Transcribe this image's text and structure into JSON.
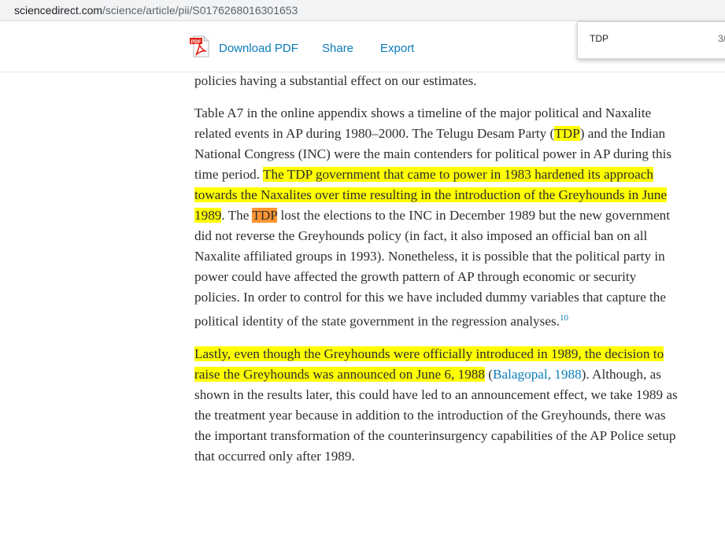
{
  "browser": {
    "url_domain": "sciencedirect.com",
    "url_path": "/science/article/pii/S0176268016301653"
  },
  "toolbar": {
    "pdf_icon_text": "PDF",
    "download_pdf": "Download PDF",
    "share": "Share",
    "export": "Export"
  },
  "find": {
    "query": "TDP",
    "count": "3/"
  },
  "colors": {
    "link": "#0c7dbb",
    "highlight": "#ffff00",
    "current_match": "#ff9632"
  },
  "article": {
    "p0": "policies having a substantial effect on our estimates.",
    "p1": {
      "s01": "Table A7 in the online appendix shows a timeline of the major political and Naxalite related events in AP during 1980–2000. The Telugu Desam Party (",
      "m1": "TDP",
      "s02": ") and the Indian National Congress (INC) were the main contenders for political power in AP during this time period. ",
      "h1": "The ",
      "m2": "TDP",
      "h2": " government that came to power in 1983 hardened its approach towards the Naxalites over time resulting in the introduction of the Greyhounds in June 1989",
      "s03": ". The ",
      "m3": "TDP",
      "s04": " lost the elections to the INC in December 1989 but the new government did not reverse the Greyhounds policy (in fact, it also imposed an official ban on all Naxalite affiliated groups in 1993). Nonetheless, it is possible that the political party in power could have affected the growth pattern of AP through economic or security policies. In order to control for this we have included dummy variables that capture the political identity of the state government in the regression analyses.",
      "footnote": "10"
    },
    "p2": {
      "h1": "Lastly, even though the Greyhounds were officially introduced in 1989, the decision to raise the Greyhounds was announced on June 6, 1988",
      "s01": " (",
      "ref": "Balagopal, 1988",
      "s02": "). Although, as shown in the results later, this could have led to an announcement effect, we take 1989 as the treatment year because in addition to the introduction of the Greyhounds, there was the important transformation of the counterinsurgency capabilities of the AP Police setup that occurred only after 1989."
    }
  }
}
